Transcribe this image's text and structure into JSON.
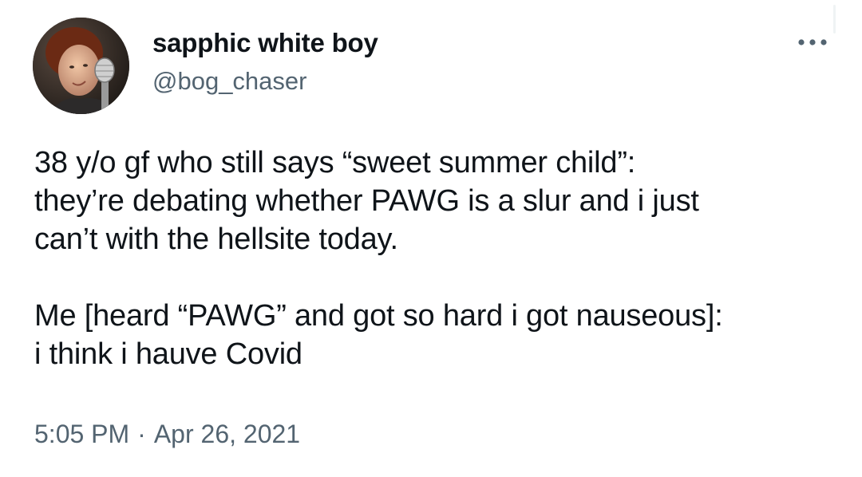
{
  "author": {
    "display_name": "sapphic white boy",
    "handle": "@bog_chaser",
    "avatar_icon": "profile-photo-avatar"
  },
  "menu": {
    "more_icon": "more-horizontal-icon"
  },
  "tweet": {
    "lines_para1": [
      "38 y/o gf who still says “sweet summer child”:",
      "they’re debating whether PAWG is a slur and i just",
      "can’t with the hellsite today."
    ],
    "lines_para2": [
      "Me [heard “PAWG” and got so hard i got nauseous]:",
      "i think i hauve Covid"
    ]
  },
  "meta": {
    "time": "5:05 PM",
    "separator": "·",
    "date": "Apr 26, 2021"
  },
  "colors": {
    "text_primary": "#0f1419",
    "text_secondary": "#536471",
    "background": "#ffffff"
  }
}
